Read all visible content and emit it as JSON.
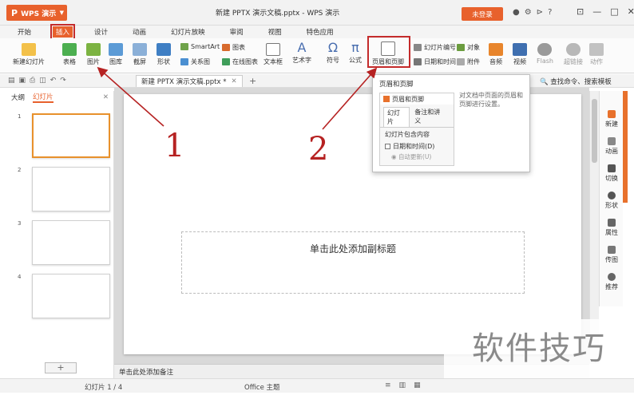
{
  "window": {
    "app_name": "WPS 演示",
    "title": "新建 PPTX 演示文稿.pptx - WPS 演示",
    "login_label": "未登录"
  },
  "menu": {
    "tabs": [
      {
        "label": "开始",
        "active": false
      },
      {
        "label": "插入",
        "active": true
      },
      {
        "label": "设计",
        "active": false
      },
      {
        "label": "动画",
        "active": false
      },
      {
        "label": "幻灯片放映",
        "active": false
      },
      {
        "label": "审阅",
        "active": false
      },
      {
        "label": "视图",
        "active": false
      },
      {
        "label": "特色应用",
        "active": false
      }
    ]
  },
  "ribbon": {
    "new_slide": "新建幻灯片",
    "table": "表格",
    "picture": "图片",
    "gallery": "图库",
    "screenshot": "截屏",
    "shape": "形状",
    "smartart": "SmartArt",
    "chart": "图表",
    "relation": "关系图",
    "online_chart": "在线图表",
    "textbox": "文本框",
    "wordart": "艺术字",
    "symbol": "符号",
    "formula": "公式",
    "header_footer": "页眉和页脚",
    "slide_number": "幻灯片编号",
    "object": "对象",
    "datetime": "日期和时间",
    "attachment": "附件",
    "audio": "音频",
    "video": "视频",
    "flash": "Flash",
    "hyperlink": "超链接",
    "action": "动作"
  },
  "quickbar": {
    "doc_tab": "新建 PPTX 演示文稿.pptx *",
    "search": "查找命令、搜索模板"
  },
  "panel": {
    "tab_outline": "大纲",
    "tab_slides": "幻灯片",
    "slides": [
      {
        "num": "1",
        "selected": true
      },
      {
        "num": "2",
        "selected": false
      },
      {
        "num": "3",
        "selected": false
      },
      {
        "num": "4",
        "selected": false
      }
    ]
  },
  "slide": {
    "subtitle_placeholder": "单击此处添加副标题"
  },
  "notes": {
    "placeholder": "单击此处添加备注"
  },
  "status": {
    "slide_count": "幻灯片 1 / 4",
    "theme": "Office 主题"
  },
  "popup": {
    "title": "页眉和页脚",
    "description": "对文档中页面的页眉和页脚进行设置。",
    "dialog_title": "页眉和页脚",
    "dialog_tab_slide": "幻灯片",
    "dialog_tab_notes": "备注和讲义",
    "dialog_section": "幻灯片包含内容",
    "dialog_check_datetime": "日期和时间(D)",
    "dialog_radio_auto": "自动更新(U)"
  },
  "rightbar": {
    "new": "新建",
    "animation": "动画",
    "switch": "切换",
    "shape": "形状",
    "property": "属性",
    "sendimg": "传图",
    "recommend": "推荐"
  },
  "annotations": {
    "label_1": "1",
    "label_2": "2",
    "arrow_color": "#b62222"
  },
  "watermark": "软件技巧",
  "colors": {
    "accent": "#e8612c",
    "highlight_box": "#c42b2b"
  }
}
